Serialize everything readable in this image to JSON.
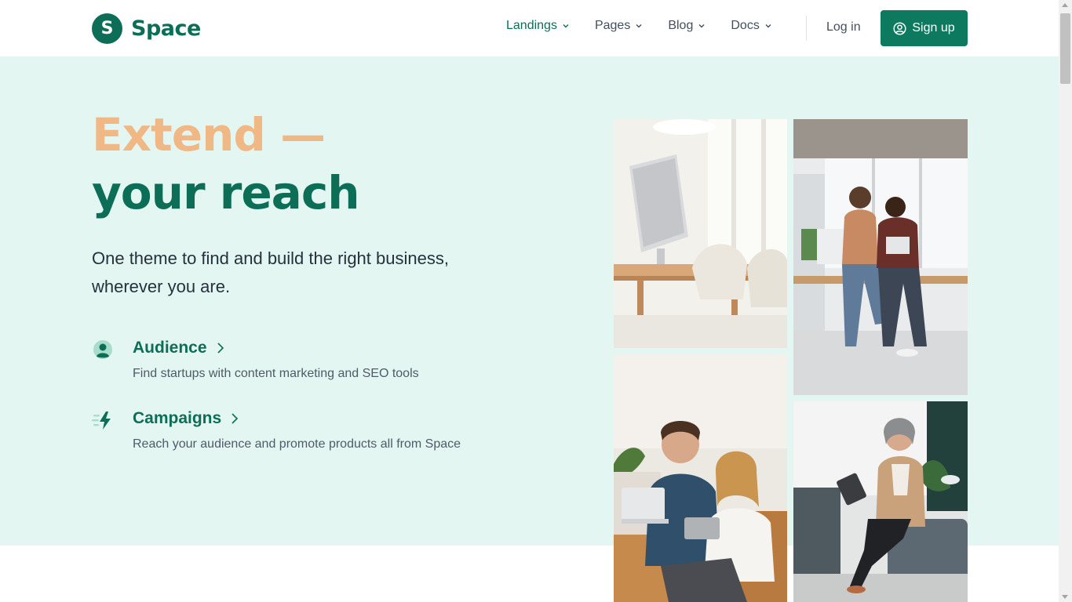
{
  "brand": {
    "logo_letter": "S",
    "name": "Space"
  },
  "nav": {
    "items": [
      {
        "label": "Landings",
        "active": true
      },
      {
        "label": "Pages",
        "active": false
      },
      {
        "label": "Blog",
        "active": false
      },
      {
        "label": "Docs",
        "active": false
      }
    ],
    "login": "Log in",
    "signup": "Sign up"
  },
  "hero": {
    "headline_1": "Extend —",
    "headline_2": "your reach",
    "lead": "One theme to find and build the right business, wherever you are.",
    "features": [
      {
        "icon": "user-circle-icon",
        "title": "Audience",
        "description": "Find startups with content marketing and SEO tools"
      },
      {
        "icon": "lightning-icon",
        "title": "Campaigns",
        "description": "Reach your audience and promote products all from Space"
      }
    ]
  },
  "colors": {
    "brand_green": "#0d6e57",
    "accent_peach": "#f0b884",
    "hero_bg": "#e4f6f1"
  }
}
